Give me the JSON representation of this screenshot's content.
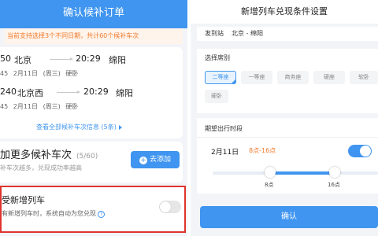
{
  "left": {
    "title": "确认候补订单",
    "notice": "当前支持选择3个不同日期，共计60个候补车次",
    "trains": [
      {
        "dep_time": "50",
        "dep_station": "北京",
        "arr_time": "20:29",
        "arr_station": "绵阳",
        "duration": "45",
        "date": "2月11日",
        "weekday": "(周三)",
        "seat": "硬卧"
      },
      {
        "dep_time": "240",
        "dep_station": "北京西",
        "arr_time": "20:29",
        "arr_station": "绵阳",
        "duration": "45",
        "date": "2月11日",
        "weekday": "(周三)",
        "seat": "硬卧"
      }
    ],
    "view_all": "查看全部候补车次信息 (5条)",
    "add_more": {
      "title": "加更多候补车次",
      "count": "(5/60)",
      "subtitle": "补车次越多，兑现成功率越高",
      "button": "去添加",
      "button_icon": "plus-icon"
    },
    "accept": {
      "title": "受新增列车",
      "subtitle": "有新增列车时，系统自动为您兑现",
      "help": "?",
      "enabled": false
    }
  },
  "right": {
    "title": "新增列车兑现条件设置",
    "station_label": "发到站",
    "station_value": "北京 - 绵阳",
    "seat_label": "选择席别",
    "seats": [
      {
        "label": "二等座",
        "selected": true
      },
      {
        "label": "一等座",
        "selected": false
      },
      {
        "label": "商务座",
        "selected": false
      },
      {
        "label": "硬座",
        "selected": false
      },
      {
        "label": "软卧",
        "selected": false
      },
      {
        "label": "硬卧",
        "selected": false
      }
    ],
    "time_label": "期望出行时段",
    "date": "2月11日",
    "range": "8点-16点",
    "time_enabled": true,
    "slider": {
      "min_label": "8点",
      "max_label": "16点",
      "min_hour": 8,
      "max_hour": 16
    },
    "confirm": "确认"
  },
  "colors": {
    "accent": "#3f95f0",
    "warning": "#f07a2b",
    "highlight_border": "#e0342e"
  }
}
